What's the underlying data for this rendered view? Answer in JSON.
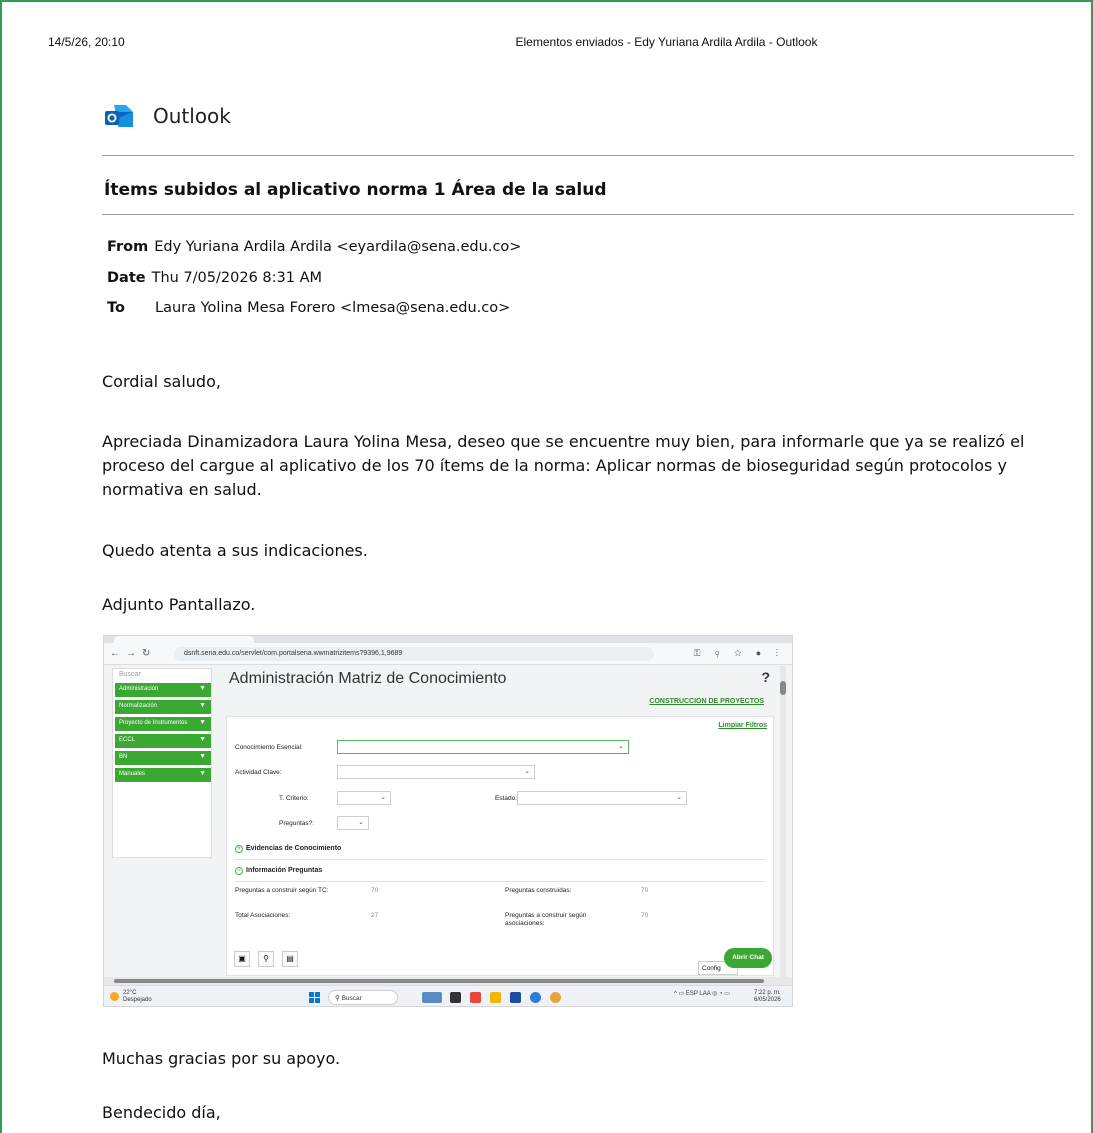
{
  "print_header": {
    "date": "14/5/26, 20:10",
    "title": "Elementos enviados - Edy Yuriana Ardila Ardila - Outlook"
  },
  "brand": {
    "name": "Outlook"
  },
  "email": {
    "subject": "Ítems subidos al aplicativo norma 1 Área de la salud",
    "from_label": "From",
    "from_value": "Edy Yuriana Ardila Ardila <eyardila@sena.edu.co>",
    "date_label": "Date",
    "date_value": "Thu 7/05/2026 8:31 AM",
    "to_label": "To",
    "to_value": "Laura Yolina Mesa Forero <lmesa@sena.edu.co>",
    "greeting": "Cordial saludo,",
    "body_1": "Apreciada Dinamizadora Laura Yolina Mesa, deseo que se encuentre muy bien, para informarle que ya se realizó el proceso del cargue al aplicativo de los 70 ítems de la norma: Aplicar normas de bioseguridad según protocolos y normativa en salud.",
    "body_2": "Quedo atenta a sus indicaciones.",
    "body_3": "Adjunto Pantallazo.",
    "closing_1": "Muchas gracias por su apoyo.",
    "closing_2": "Bendecido día,"
  },
  "screenshot": {
    "url": "dsnft.sena.edu.co/servlet/com.portalsena.wwmatrizitems?9396,1,9689",
    "sidebar": {
      "search": "Buscar",
      "items": [
        "Administración",
        "Normalización",
        "Proyecto de Instrumentos",
        "ECCL",
        "BN",
        "Manuales"
      ]
    },
    "app_title": "Administración Matriz de Conocimiento",
    "help": "?",
    "link_projects": "CONSTRUCCION DE PROYECTOS",
    "link_filters": "Limpiar Filtros",
    "fields": {
      "conocimiento": "Conocimiento Esencial:",
      "actividad": "Actividad Clave:",
      "criterio": "T. Criterio:",
      "estado": "Estado:",
      "preguntas": "Preguntas?:"
    },
    "section_evidencias": "Evidencias de Conocimiento",
    "section_info": "Información Preguntas",
    "stats": {
      "l1": "Preguntas a construir según TC:",
      "v1": "70",
      "l2": "Preguntas construidas:",
      "v2": "70",
      "l3": "Total Asociaciones:",
      "v3": "27",
      "l4": "Preguntas a construir según asociaciones:",
      "v4": "70"
    },
    "config": "Config",
    "chat": "Abrir Chat",
    "taskbar": {
      "temp": "22°C",
      "weather": "Despejado",
      "search": "Buscar",
      "lang": "ESP LAA",
      "time": "7:22 p. m.",
      "date": "6/05/2026"
    }
  }
}
